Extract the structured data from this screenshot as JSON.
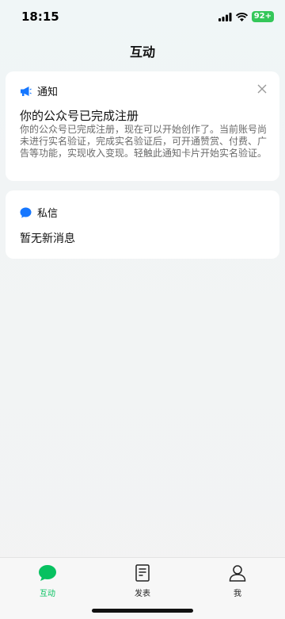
{
  "status_bar": {
    "time": "18:15",
    "battery": "92+"
  },
  "nav": {
    "title": "互动"
  },
  "notice_card": {
    "header": "通知",
    "title": "你的公众号已完成注册",
    "body": "你的公众号已完成注册，现在可以开始创作了。当前账号尚未进行实名验证，完成实名验证后，可开通赞赏、付费、广告等功能，实现收入变现。轻触此通知卡片开始实名验证。"
  },
  "dm_card": {
    "header": "私信",
    "empty_text": "暂无新消息"
  },
  "tabs": [
    {
      "label": "互动",
      "icon": "chat-bubble-icon",
      "active": true
    },
    {
      "label": "发表",
      "icon": "document-icon",
      "active": false
    },
    {
      "label": "我",
      "icon": "person-icon",
      "active": false
    }
  ],
  "colors": {
    "accent": "#07c160",
    "notice_icon": "#1677ff",
    "dm_icon": "#1677ff"
  }
}
